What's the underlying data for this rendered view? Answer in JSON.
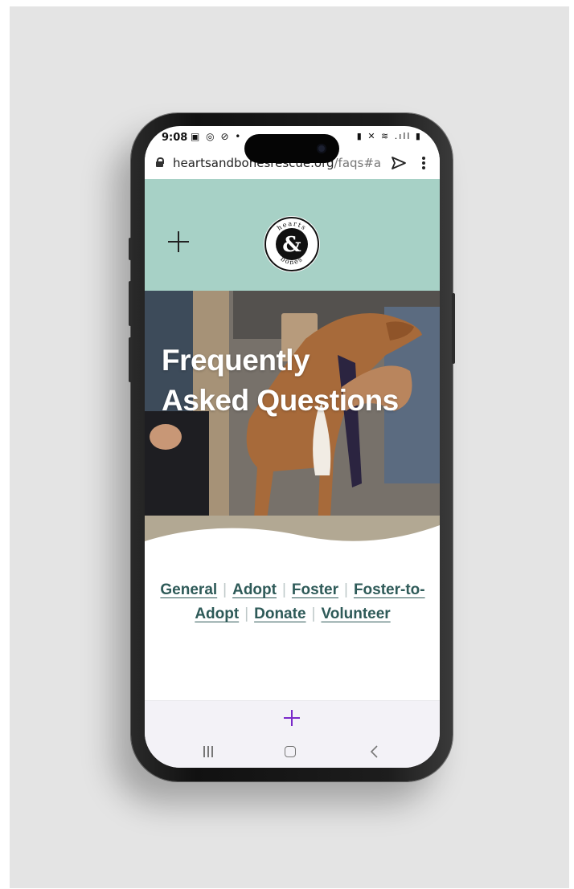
{
  "status_bar": {
    "time": "9:08",
    "left_icons": "▣ ◎ ⊘ •",
    "right_icons": "▮ ✕ ≋ .ıll ▮"
  },
  "browser": {
    "url_host": "heartsandbonesrescue.org",
    "url_path": "/faqs#ado"
  },
  "site": {
    "logo_top_text": "hearts",
    "logo_symbol": "&",
    "logo_bottom_text": "bones",
    "hero_title_line1": "Frequently",
    "hero_title_line2": "Asked Questions"
  },
  "categories": [
    {
      "label": "General"
    },
    {
      "label": "Adopt"
    },
    {
      "label": "Foster"
    },
    {
      "label": "Foster-to-Adopt"
    },
    {
      "label": "Donate"
    },
    {
      "label": "Volunteer"
    }
  ],
  "colors": {
    "header_bg": "#a7d1c6",
    "link": "#2e5a58",
    "accent_plus": "#7a29c9"
  }
}
